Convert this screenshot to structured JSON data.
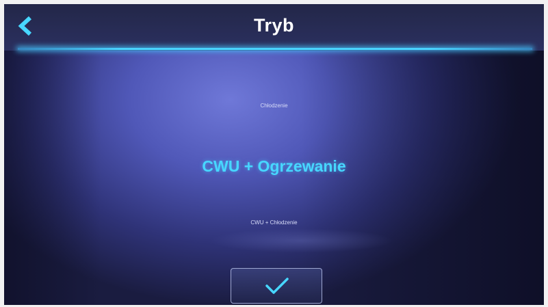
{
  "header": {
    "title": "Tryb",
    "back_icon": "chevron-left-icon"
  },
  "mode_picker": {
    "options": [
      {
        "label": "Chłodzenie",
        "state": "above"
      },
      {
        "label": "CWU + Ogrzewanie",
        "state": "selected"
      },
      {
        "label": "CWU + Chłodzenie",
        "state": "below"
      }
    ]
  },
  "confirm": {
    "icon": "checkmark-icon"
  },
  "colors": {
    "accent": "#47d7ff",
    "title_text": "#ffffff",
    "header_background": "#232748",
    "screen_background": "#5058b8"
  }
}
